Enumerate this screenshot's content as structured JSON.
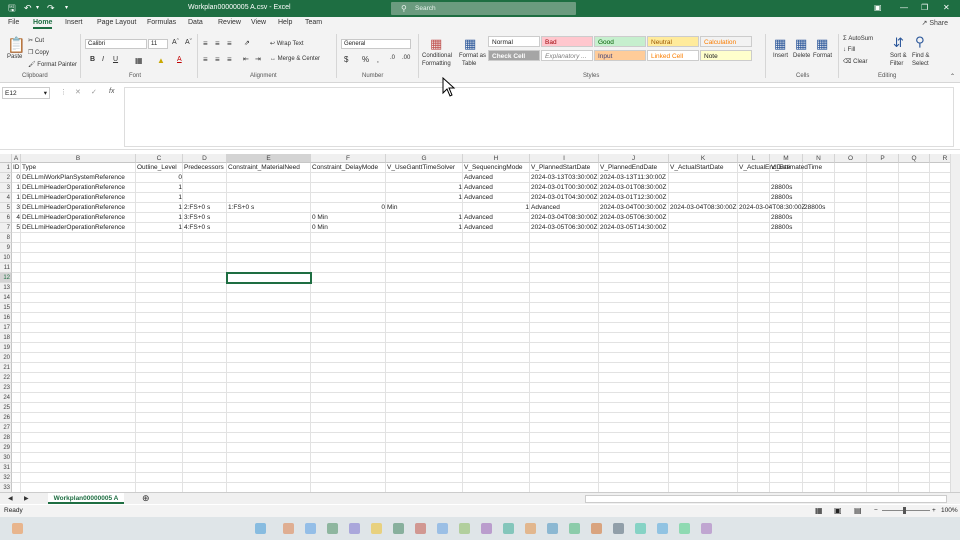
{
  "titlebar": {
    "title": "Workplan00000005 A.csv - Excel",
    "search_placeholder": "Search"
  },
  "tabs": [
    "File",
    "Home",
    "Insert",
    "Page Layout",
    "Formulas",
    "Data",
    "Review",
    "View",
    "Help",
    "Team"
  ],
  "active_tab": "Home",
  "share_label": "Share",
  "ribbon": {
    "clipboard": {
      "paste": "Paste",
      "cut": "Cut",
      "copy": "Copy",
      "format_painter": "Format Painter",
      "label": "Clipboard"
    },
    "font": {
      "name": "Calibri",
      "size": "11",
      "label": "Font"
    },
    "alignment": {
      "wrap": "Wrap Text",
      "merge": "Merge & Center",
      "label": "Alignment"
    },
    "number": {
      "format": "General",
      "label": "Number"
    },
    "styles": {
      "conditional": "Conditional",
      "conditional2": "Formatting",
      "format_as": "Format as",
      "format_as2": "Table",
      "cells": [
        {
          "label": "Normal",
          "bg": "#ffffff",
          "fg": "#222222"
        },
        {
          "label": "Bad",
          "bg": "#ffc7ce",
          "fg": "#9c0006"
        },
        {
          "label": "Good",
          "bg": "#c6efce",
          "fg": "#006100"
        },
        {
          "label": "Neutral",
          "bg": "#ffeb9c",
          "fg": "#9c5700"
        },
        {
          "label": "Calculation",
          "bg": "#f2f2f2",
          "fg": "#fa7d00"
        },
        {
          "label": "Check Cell",
          "bg": "#a5a5a5",
          "fg": "#ffffff"
        },
        {
          "label": "Explanatory ...",
          "bg": "#ffffff",
          "fg": "#7f7f7f"
        },
        {
          "label": "Input",
          "bg": "#ffcc99",
          "fg": "#3f3f76"
        },
        {
          "label": "Linked Cell",
          "bg": "#ffffff",
          "fg": "#fa7d00"
        },
        {
          "label": "Note",
          "bg": "#ffffcc",
          "fg": "#222222"
        }
      ],
      "label": "Styles"
    },
    "cells": {
      "insert": "Insert",
      "delete": "Delete",
      "format": "Format",
      "label": "Cells"
    },
    "editing": {
      "autosum": "AutoSum",
      "fill": "Fill",
      "clear": "Clear",
      "sort": "Sort &",
      "sort2": "Filter",
      "find": "Find &",
      "find2": "Select",
      "label": "Editing"
    }
  },
  "namebox": "E12",
  "columns": [
    {
      "letter": "A",
      "w": 9
    },
    {
      "letter": "B",
      "w": 115
    },
    {
      "letter": "C",
      "w": 47
    },
    {
      "letter": "D",
      "w": 44
    },
    {
      "letter": "E",
      "w": 84
    },
    {
      "letter": "F",
      "w": 75
    },
    {
      "letter": "G",
      "w": 77
    },
    {
      "letter": "H",
      "w": 67
    },
    {
      "letter": "I",
      "w": 69
    },
    {
      "letter": "J",
      "w": 70
    },
    {
      "letter": "K",
      "w": 69
    },
    {
      "letter": "L",
      "w": 32
    },
    {
      "letter": "M",
      "w": 33
    },
    {
      "letter": "N",
      "w": 32
    },
    {
      "letter": "O",
      "w": 32
    },
    {
      "letter": "P",
      "w": 32
    },
    {
      "letter": "Q",
      "w": 31
    },
    {
      "letter": "R",
      "w": 31
    }
  ],
  "rows": [
    [
      {
        "c": 0,
        "v": "ID"
      },
      {
        "c": 1,
        "v": "Type"
      },
      {
        "c": 2,
        "v": "Outline_Level"
      },
      {
        "c": 3,
        "v": "Predecessors"
      },
      {
        "c": 4,
        "v": "Constraint_MaterialNeed"
      },
      {
        "c": 5,
        "v": "Constraint_DelayMode"
      },
      {
        "c": 6,
        "v": "V_UseGanttTimeSolver"
      },
      {
        "c": 7,
        "v": "V_SequencingMode"
      },
      {
        "c": 8,
        "v": "V_PlannedStartDate"
      },
      {
        "c": 9,
        "v": "V_PlannedEndDate"
      },
      {
        "c": 10,
        "v": "V_ActualStartDate"
      },
      {
        "c": 11,
        "v": "V_ActualEndDate"
      },
      {
        "c": 12,
        "v": "V_EstimatedTime"
      }
    ],
    [
      {
        "c": 0,
        "v": "0",
        "n": 1
      },
      {
        "c": 1,
        "v": "DELLmiWorkPlanSystemReference"
      },
      {
        "c": 2,
        "v": "0",
        "n": 1
      },
      {
        "c": 7,
        "v": "Advanced"
      },
      {
        "c": 8,
        "v": "2024-03-13T03:30:00Z"
      },
      {
        "c": 9,
        "v": "2024-03-13T11:30:00Z"
      }
    ],
    [
      {
        "c": 0,
        "v": "1",
        "n": 1
      },
      {
        "c": 1,
        "v": "DELLmiHeaderOperationReference"
      },
      {
        "c": 2,
        "v": "1",
        "n": 1
      },
      {
        "c": 6,
        "v": "1",
        "n": 1
      },
      {
        "c": 7,
        "v": "Advanced"
      },
      {
        "c": 8,
        "v": "2024-03-01T00:30:00Z"
      },
      {
        "c": 9,
        "v": "2024-03-01T08:30:00Z"
      },
      {
        "c": 12,
        "v": "28800s"
      }
    ],
    [
      {
        "c": 0,
        "v": "1",
        "n": 1
      },
      {
        "c": 1,
        "v": "DELLmiHeaderOperationReference"
      },
      {
        "c": 2,
        "v": "1",
        "n": 1
      },
      {
        "c": 6,
        "v": "1",
        "n": 1
      },
      {
        "c": 7,
        "v": "Advanced"
      },
      {
        "c": 8,
        "v": "2024-03-01T04:30:00Z"
      },
      {
        "c": 9,
        "v": "2024-03-01T12:30:00Z"
      },
      {
        "c": 12,
        "v": "28800s"
      }
    ],
    [
      {
        "c": 0,
        "v": "3",
        "n": 1
      },
      {
        "c": 1,
        "v": "DELLmiHeaderOperationReference"
      },
      {
        "c": 2,
        "v": "1",
        "n": 1
      },
      {
        "c": 3,
        "v": "2:FS+0 s"
      },
      {
        "c": 4,
        "v": "1:FS+0 s"
      },
      {
        "c": 5,
        "v": "0",
        "n": 1
      },
      {
        "c": 6,
        "v": "Min"
      },
      {
        "c": 7,
        "v": "1",
        "n": 1
      },
      {
        "c": 8,
        "v": "Advanced"
      },
      {
        "c": 9,
        "v": "2024-03-04T00:30:00Z"
      },
      {
        "c": 10,
        "v": "2024-03-04T08:30:00Z"
      },
      {
        "c": 11,
        "v": "2024-03-04T08:30:00Z"
      },
      {
        "c": 13,
        "v": "28800s"
      }
    ],
    [
      {
        "c": 0,
        "v": "4",
        "n": 1
      },
      {
        "c": 1,
        "v": "DELLmiHeaderOperationReference"
      },
      {
        "c": 2,
        "v": "1",
        "n": 1
      },
      {
        "c": 3,
        "v": "3:FS+0 s"
      },
      {
        "c": 5,
        "v": "0 Min"
      },
      {
        "c": 6,
        "v": "1",
        "n": 1
      },
      {
        "c": 7,
        "v": "Advanced"
      },
      {
        "c": 8,
        "v": "2024-03-04T08:30:00Z"
      },
      {
        "c": 9,
        "v": "2024-03-05T06:30:00Z"
      },
      {
        "c": 12,
        "v": "28800s"
      }
    ],
    [
      {
        "c": 0,
        "v": "5",
        "n": 1
      },
      {
        "c": 1,
        "v": "DELLmiHeaderOperationReference"
      },
      {
        "c": 2,
        "v": "1",
        "n": 1
      },
      {
        "c": 3,
        "v": "4:FS+0 s"
      },
      {
        "c": 5,
        "v": "0 Min"
      },
      {
        "c": 6,
        "v": "1",
        "n": 1
      },
      {
        "c": 7,
        "v": "Advanced"
      },
      {
        "c": 8,
        "v": "2024-03-05T06:30:00Z"
      },
      {
        "c": 9,
        "v": "2024-03-05T14:30:00Z"
      },
      {
        "c": 12,
        "v": "28800s"
      }
    ]
  ],
  "row_count": 33,
  "selected_cell": {
    "col": 4,
    "row": 12
  },
  "sheet_tab": "Workplan00000005 A",
  "status": {
    "ready": "Ready",
    "zoom": "100%"
  }
}
